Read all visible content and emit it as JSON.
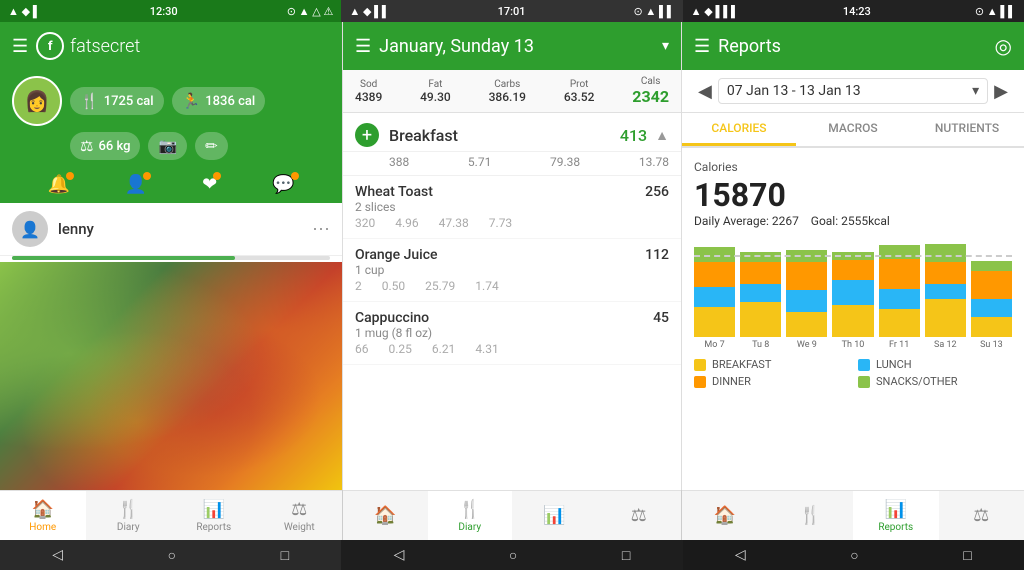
{
  "statusBars": [
    {
      "time": "12:30",
      "leftIcons": "▲ ◆ ▌",
      "rightIcons": "⊙ ▲ △ ⚠"
    },
    {
      "time": "17:01",
      "leftIcons": "▲ ◆ ▌▌",
      "rightIcons": "⊙ ▲ ▌▌"
    },
    {
      "time": "14:23",
      "leftIcons": "▲ ◆ ▌▌▌",
      "rightIcons": "⊙ ▲ ▌▌"
    }
  ],
  "panel1": {
    "appName": "fatsecret",
    "stats": [
      {
        "icon": "🍴",
        "value": "1725 cal"
      },
      {
        "icon": "🏃",
        "value": "1836 cal"
      }
    ],
    "weightStat": {
      "icon": "⚖",
      "value": "66 kg"
    },
    "cameraStat": {
      "icon": "📷"
    },
    "editStat": {
      "icon": "✏"
    },
    "homeIcons": [
      "🔔",
      "👤",
      "❤",
      "💬"
    ],
    "user": "lenny",
    "navItems": [
      {
        "icon": "🏠",
        "label": "Home",
        "active": true
      },
      {
        "icon": "🍴",
        "label": "Diary",
        "active": false
      },
      {
        "icon": "📊",
        "label": "Reports",
        "active": false
      },
      {
        "icon": "⚖",
        "label": "Weight",
        "active": false
      }
    ]
  },
  "panel2": {
    "title": "January, Sunday 13",
    "totals": {
      "sod": {
        "label": "Sod",
        "value": "4389"
      },
      "fat": {
        "label": "Fat",
        "value": "49.30"
      },
      "carbs": {
        "label": "Carbs",
        "value": "386.19"
      },
      "prot": {
        "label": "Prot",
        "value": "63.52"
      },
      "cals": {
        "label": "Cals",
        "value": "2342"
      }
    },
    "meals": [
      {
        "name": "Breakfast",
        "calories": "413",
        "macros": {
          "sod": "388",
          "fat": "5.71",
          "carbs": "79.38",
          "prot": "13.78"
        },
        "foods": [
          {
            "name": "Wheat Toast",
            "calories": "256",
            "serving": "2 slices",
            "macros": {
              "sod": "320",
              "fat": "4.96",
              "carbs": "47.38",
              "prot": "7.73"
            }
          },
          {
            "name": "Orange Juice",
            "calories": "112",
            "serving": "1 cup",
            "macros": {
              "sod": "2",
              "fat": "0.50",
              "carbs": "25.79",
              "prot": "1.74"
            }
          },
          {
            "name": "Cappuccino",
            "calories": "45",
            "serving": "1 mug (8 fl oz)",
            "macros": {
              "sod": "66",
              "fat": "0.25",
              "carbs": "6.21",
              "prot": "4.31"
            }
          }
        ]
      }
    ],
    "navItems": [
      {
        "icon": "🏠",
        "label": "",
        "active": false
      },
      {
        "icon": "🍴",
        "label": "Diary",
        "active": true
      },
      {
        "icon": "📊",
        "label": "",
        "active": false
      },
      {
        "icon": "⚖",
        "label": "",
        "active": false
      }
    ]
  },
  "panel3": {
    "title": "Reports",
    "dateRange": "07 Jan 13 - 13 Jan 13",
    "tabs": [
      {
        "label": "CALORIES",
        "active": true
      },
      {
        "label": "MACROS",
        "active": false
      },
      {
        "label": "NUTRIENTS",
        "active": false
      }
    ],
    "calories": {
      "label": "Calories",
      "total": "15870",
      "dailyAvg": "Daily Average: 2267",
      "goal": "Goal: 2555kcal"
    },
    "chart": {
      "bars": [
        {
          "label": "Mo 7",
          "breakfast": 30,
          "lunch": 20,
          "dinner": 25,
          "snacks": 15
        },
        {
          "label": "Tu 8",
          "breakfast": 35,
          "lunch": 18,
          "dinner": 22,
          "snacks": 10
        },
        {
          "label": "We 9",
          "breakfast": 25,
          "lunch": 22,
          "dinner": 28,
          "snacks": 12
        },
        {
          "label": "Th 10",
          "breakfast": 32,
          "lunch": 25,
          "dinner": 20,
          "snacks": 8
        },
        {
          "label": "Fr 11",
          "breakfast": 28,
          "lunch": 20,
          "dinner": 30,
          "snacks": 14
        },
        {
          "label": "Sa 12",
          "breakfast": 38,
          "lunch": 15,
          "dinner": 22,
          "snacks": 18
        },
        {
          "label": "Su 13",
          "breakfast": 20,
          "lunch": 18,
          "dinner": 28,
          "snacks": 10
        }
      ]
    },
    "legend": [
      {
        "label": "BREAKFAST",
        "color": "#f5c518"
      },
      {
        "label": "LUNCH",
        "color": "#29b6f6"
      },
      {
        "label": "DINNER",
        "color": "#ff9800"
      },
      {
        "label": "SNACKS/OTHER",
        "color": "#8bc34a"
      }
    ],
    "navItems": [
      {
        "icon": "🏠",
        "label": "",
        "active": false
      },
      {
        "icon": "🍴",
        "label": "",
        "active": false
      },
      {
        "icon": "📊",
        "label": "Reports",
        "active": true
      },
      {
        "icon": "⚖",
        "label": "",
        "active": false
      }
    ]
  },
  "sysNav": {
    "buttons": [
      "◁",
      "○",
      "□"
    ]
  }
}
